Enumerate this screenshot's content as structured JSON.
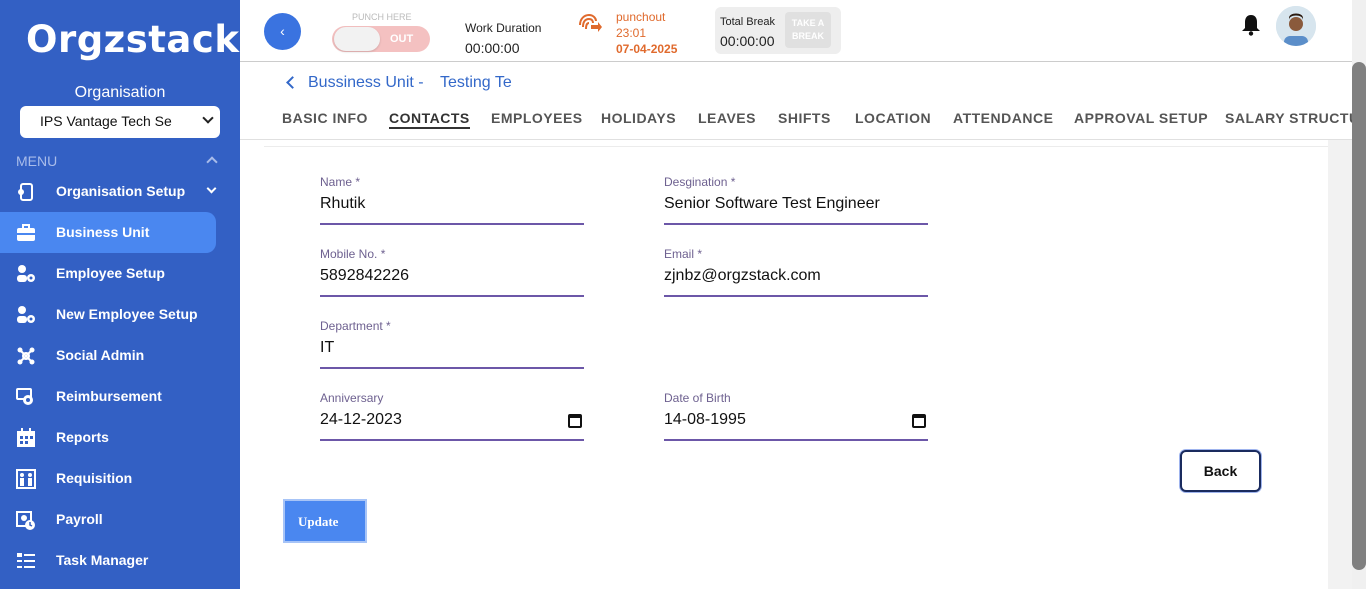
{
  "brand": {
    "logo_text": "Orgzstack"
  },
  "sidebar": {
    "org_label": "Organisation",
    "org_select": "IPS Vantage Tech Se",
    "menu_label": "MENU",
    "items": [
      {
        "label": "Organisation Setup",
        "icon": "org-setup-icon"
      },
      {
        "label": "Business Unit",
        "icon": "briefcase-icon"
      },
      {
        "label": "Employee Setup",
        "icon": "employee-gear-icon"
      },
      {
        "label": "New Employee Setup",
        "icon": "employee-gear-icon"
      },
      {
        "label": "Social Admin",
        "icon": "social-icon"
      },
      {
        "label": "Reimbursement",
        "icon": "reimbursement-icon"
      },
      {
        "label": "Reports",
        "icon": "calendar-grid-icon"
      },
      {
        "label": "Requisition",
        "icon": "requisition-icon"
      },
      {
        "label": "Payroll",
        "icon": "payroll-icon"
      },
      {
        "label": "Task Manager",
        "icon": "task-list-icon"
      }
    ]
  },
  "topbar": {
    "punch_here": "PUNCH HERE",
    "punch_toggle": "OUT",
    "work_duration_title": "Work Duration",
    "work_duration_value": "00:00:00",
    "punchout_label": "punchout",
    "punchout_time": "23:01",
    "punchout_date": "07-04-2025",
    "total_break_title": "Total Break",
    "total_break_value": "00:00:00",
    "take_break_line1": "TAKE A",
    "take_break_line2": "BREAK"
  },
  "breadcrumb": {
    "title": "Bussiness Unit -",
    "name": "Testing Te"
  },
  "tabs": [
    "BASIC INFO",
    "CONTACTS",
    "EMPLOYEES",
    "HOLIDAYS",
    "LEAVES",
    "SHIFTS",
    "LOCATION",
    "ATTENDANCE",
    "APPROVAL SETUP",
    "SALARY STRUCTUR"
  ],
  "form": {
    "name": {
      "label": "Name *",
      "value": "Rhutik"
    },
    "designation": {
      "label": "Desgination *",
      "value": "Senior Software Test Engineer"
    },
    "mobile": {
      "label": "Mobile No. *",
      "value": "5892842226"
    },
    "email": {
      "label": "Email *",
      "value": "zjnbz@orgzstack.com"
    },
    "department": {
      "label": "Department *",
      "value": "IT"
    },
    "anniversary": {
      "label": "Anniversary",
      "value": "24-12-2023"
    },
    "dob": {
      "label": "Date of Birth",
      "value": "14-08-1995"
    }
  },
  "buttons": {
    "back": "Back",
    "update": "Update"
  }
}
